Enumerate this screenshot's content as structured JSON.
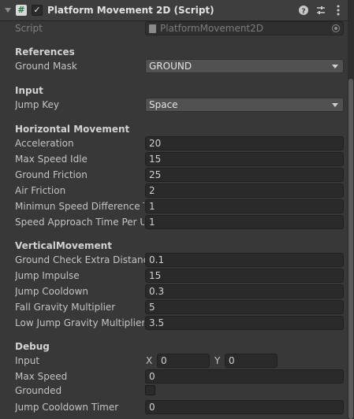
{
  "component": {
    "title": "Platform Movement 2D (Script)",
    "icons": [
      "help-icon",
      "preset-icon",
      "more-icon"
    ],
    "enabled": true
  },
  "script_field": {
    "label": "Script",
    "value": "PlatformMovement2D"
  },
  "references": {
    "header": "References",
    "ground_mask": {
      "label": "Ground Mask",
      "value": "GROUND"
    }
  },
  "input": {
    "header": "Input",
    "jump_key": {
      "label": "Jump Key",
      "value": "Space"
    }
  },
  "horizontal": {
    "header": "Horizontal Movement",
    "fields": [
      {
        "label": "Acceleration",
        "value": "20"
      },
      {
        "label": "Max Speed Idle",
        "value": "15"
      },
      {
        "label": "Ground Friction",
        "value": "25"
      },
      {
        "label": "Air Friction",
        "value": "2"
      },
      {
        "label": "Minimun Speed Difference To",
        "value": "1"
      },
      {
        "label": "Speed Approach Time Per Unit",
        "value": "1"
      }
    ]
  },
  "vertical": {
    "header": "VerticalMovement",
    "fields": [
      {
        "label": "Ground Check Extra Distance",
        "value": "0.1"
      },
      {
        "label": "Jump Impulse",
        "value": "15"
      },
      {
        "label": "Jump Cooldown",
        "value": "0.3"
      },
      {
        "label": "Fall Gravity Multiplier",
        "value": "5"
      },
      {
        "label": "Low Jump Gravity Multiplier",
        "value": "3.5"
      }
    ]
  },
  "debug": {
    "header": "Debug",
    "input": {
      "label": "Input",
      "x_label": "X",
      "x_value": "0",
      "y_label": "Y",
      "y_value": "0"
    },
    "max_speed": {
      "label": "Max Speed",
      "value": "0"
    },
    "grounded": {
      "label": "Grounded",
      "checked": false
    },
    "jump_cooldown_timer": {
      "label": "Jump Cooldown Timer",
      "value": "0"
    }
  },
  "colors": {
    "background": "#383838",
    "field_bg": "#2a2a2a",
    "dropdown_bg": "#515151",
    "text": "#c4c4c4"
  }
}
